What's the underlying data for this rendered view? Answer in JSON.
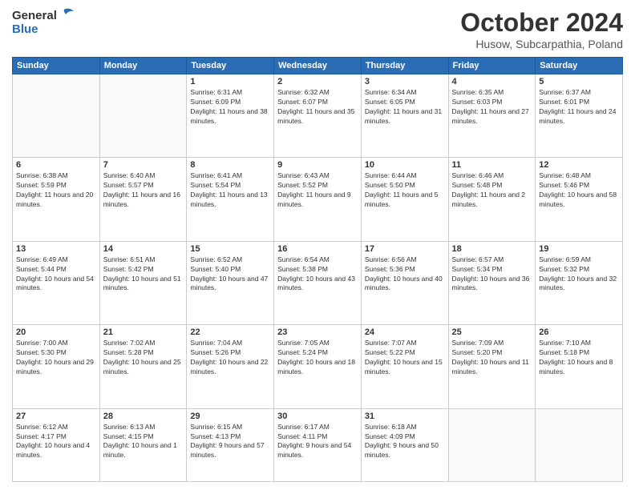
{
  "logo": {
    "general": "General",
    "blue": "Blue"
  },
  "title": {
    "month": "October 2024",
    "location": "Husow, Subcarpathia, Poland"
  },
  "headers": [
    "Sunday",
    "Monday",
    "Tuesday",
    "Wednesday",
    "Thursday",
    "Friday",
    "Saturday"
  ],
  "weeks": [
    [
      {
        "day": "",
        "sunrise": "",
        "sunset": "",
        "daylight": ""
      },
      {
        "day": "",
        "sunrise": "",
        "sunset": "",
        "daylight": ""
      },
      {
        "day": "1",
        "sunrise": "Sunrise: 6:31 AM",
        "sunset": "Sunset: 6:09 PM",
        "daylight": "Daylight: 11 hours and 38 minutes."
      },
      {
        "day": "2",
        "sunrise": "Sunrise: 6:32 AM",
        "sunset": "Sunset: 6:07 PM",
        "daylight": "Daylight: 11 hours and 35 minutes."
      },
      {
        "day": "3",
        "sunrise": "Sunrise: 6:34 AM",
        "sunset": "Sunset: 6:05 PM",
        "daylight": "Daylight: 11 hours and 31 minutes."
      },
      {
        "day": "4",
        "sunrise": "Sunrise: 6:35 AM",
        "sunset": "Sunset: 6:03 PM",
        "daylight": "Daylight: 11 hours and 27 minutes."
      },
      {
        "day": "5",
        "sunrise": "Sunrise: 6:37 AM",
        "sunset": "Sunset: 6:01 PM",
        "daylight": "Daylight: 11 hours and 24 minutes."
      }
    ],
    [
      {
        "day": "6",
        "sunrise": "Sunrise: 6:38 AM",
        "sunset": "Sunset: 5:59 PM",
        "daylight": "Daylight: 11 hours and 20 minutes."
      },
      {
        "day": "7",
        "sunrise": "Sunrise: 6:40 AM",
        "sunset": "Sunset: 5:57 PM",
        "daylight": "Daylight: 11 hours and 16 minutes."
      },
      {
        "day": "8",
        "sunrise": "Sunrise: 6:41 AM",
        "sunset": "Sunset: 5:54 PM",
        "daylight": "Daylight: 11 hours and 13 minutes."
      },
      {
        "day": "9",
        "sunrise": "Sunrise: 6:43 AM",
        "sunset": "Sunset: 5:52 PM",
        "daylight": "Daylight: 11 hours and 9 minutes."
      },
      {
        "day": "10",
        "sunrise": "Sunrise: 6:44 AM",
        "sunset": "Sunset: 5:50 PM",
        "daylight": "Daylight: 11 hours and 5 minutes."
      },
      {
        "day": "11",
        "sunrise": "Sunrise: 6:46 AM",
        "sunset": "Sunset: 5:48 PM",
        "daylight": "Daylight: 11 hours and 2 minutes."
      },
      {
        "day": "12",
        "sunrise": "Sunrise: 6:48 AM",
        "sunset": "Sunset: 5:46 PM",
        "daylight": "Daylight: 10 hours and 58 minutes."
      }
    ],
    [
      {
        "day": "13",
        "sunrise": "Sunrise: 6:49 AM",
        "sunset": "Sunset: 5:44 PM",
        "daylight": "Daylight: 10 hours and 54 minutes."
      },
      {
        "day": "14",
        "sunrise": "Sunrise: 6:51 AM",
        "sunset": "Sunset: 5:42 PM",
        "daylight": "Daylight: 10 hours and 51 minutes."
      },
      {
        "day": "15",
        "sunrise": "Sunrise: 6:52 AM",
        "sunset": "Sunset: 5:40 PM",
        "daylight": "Daylight: 10 hours and 47 minutes."
      },
      {
        "day": "16",
        "sunrise": "Sunrise: 6:54 AM",
        "sunset": "Sunset: 5:38 PM",
        "daylight": "Daylight: 10 hours and 43 minutes."
      },
      {
        "day": "17",
        "sunrise": "Sunrise: 6:56 AM",
        "sunset": "Sunset: 5:36 PM",
        "daylight": "Daylight: 10 hours and 40 minutes."
      },
      {
        "day": "18",
        "sunrise": "Sunrise: 6:57 AM",
        "sunset": "Sunset: 5:34 PM",
        "daylight": "Daylight: 10 hours and 36 minutes."
      },
      {
        "day": "19",
        "sunrise": "Sunrise: 6:59 AM",
        "sunset": "Sunset: 5:32 PM",
        "daylight": "Daylight: 10 hours and 32 minutes."
      }
    ],
    [
      {
        "day": "20",
        "sunrise": "Sunrise: 7:00 AM",
        "sunset": "Sunset: 5:30 PM",
        "daylight": "Daylight: 10 hours and 29 minutes."
      },
      {
        "day": "21",
        "sunrise": "Sunrise: 7:02 AM",
        "sunset": "Sunset: 5:28 PM",
        "daylight": "Daylight: 10 hours and 25 minutes."
      },
      {
        "day": "22",
        "sunrise": "Sunrise: 7:04 AM",
        "sunset": "Sunset: 5:26 PM",
        "daylight": "Daylight: 10 hours and 22 minutes."
      },
      {
        "day": "23",
        "sunrise": "Sunrise: 7:05 AM",
        "sunset": "Sunset: 5:24 PM",
        "daylight": "Daylight: 10 hours and 18 minutes."
      },
      {
        "day": "24",
        "sunrise": "Sunrise: 7:07 AM",
        "sunset": "Sunset: 5:22 PM",
        "daylight": "Daylight: 10 hours and 15 minutes."
      },
      {
        "day": "25",
        "sunrise": "Sunrise: 7:09 AM",
        "sunset": "Sunset: 5:20 PM",
        "daylight": "Daylight: 10 hours and 11 minutes."
      },
      {
        "day": "26",
        "sunrise": "Sunrise: 7:10 AM",
        "sunset": "Sunset: 5:18 PM",
        "daylight": "Daylight: 10 hours and 8 minutes."
      }
    ],
    [
      {
        "day": "27",
        "sunrise": "Sunrise: 6:12 AM",
        "sunset": "Sunset: 4:17 PM",
        "daylight": "Daylight: 10 hours and 4 minutes."
      },
      {
        "day": "28",
        "sunrise": "Sunrise: 6:13 AM",
        "sunset": "Sunset: 4:15 PM",
        "daylight": "Daylight: 10 hours and 1 minute."
      },
      {
        "day": "29",
        "sunrise": "Sunrise: 6:15 AM",
        "sunset": "Sunset: 4:13 PM",
        "daylight": "Daylight: 9 hours and 57 minutes."
      },
      {
        "day": "30",
        "sunrise": "Sunrise: 6:17 AM",
        "sunset": "Sunset: 4:11 PM",
        "daylight": "Daylight: 9 hours and 54 minutes."
      },
      {
        "day": "31",
        "sunrise": "Sunrise: 6:18 AM",
        "sunset": "Sunset: 4:09 PM",
        "daylight": "Daylight: 9 hours and 50 minutes."
      },
      {
        "day": "",
        "sunrise": "",
        "sunset": "",
        "daylight": ""
      },
      {
        "day": "",
        "sunrise": "",
        "sunset": "",
        "daylight": ""
      }
    ]
  ]
}
